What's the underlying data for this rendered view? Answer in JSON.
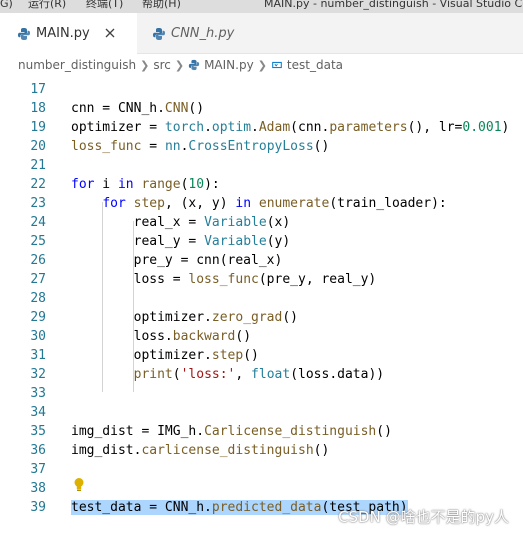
{
  "menu": {
    "edge_label": "G)",
    "run_label": "运行(R)",
    "terminal_label": "终端(T)",
    "help_label": "帮助(H)"
  },
  "window": {
    "title": "MAIN.py - number_distinguish - Visual Studio Co"
  },
  "tabs": [
    {
      "label": "MAIN.py",
      "active": true,
      "icon": "python-icon"
    },
    {
      "label": "CNN_h.py",
      "active": false,
      "icon": "python-icon"
    }
  ],
  "breadcrumb": {
    "folder": "number_distinguish",
    "src": "src",
    "file": "MAIN.py",
    "symbol": "test_data"
  },
  "editor": {
    "lines": [
      {
        "n": "17",
        "code": ""
      },
      {
        "n": "18",
        "code": "cnn = CNN_h.CNN()"
      },
      {
        "n": "19",
        "code": "optimizer = torch.optim.Adam(cnn.parameters(), lr=0.001)"
      },
      {
        "n": "20",
        "code": "loss_func = nn.CrossEntropyLoss()"
      },
      {
        "n": "21",
        "code": ""
      },
      {
        "n": "22",
        "code": "for i in range(10):"
      },
      {
        "n": "23",
        "code": "    for step, (x, y) in enumerate(train_loader):"
      },
      {
        "n": "24",
        "code": "        real_x = Variable(x)"
      },
      {
        "n": "25",
        "code": "        real_y = Variable(y)"
      },
      {
        "n": "26",
        "code": "        pre_y = cnn(real_x)"
      },
      {
        "n": "27",
        "code": "        loss = loss_func(pre_y, real_y)"
      },
      {
        "n": "28",
        "code": ""
      },
      {
        "n": "29",
        "code": "        optimizer.zero_grad()"
      },
      {
        "n": "30",
        "code": "        loss.backward()"
      },
      {
        "n": "31",
        "code": "        optimizer.step()"
      },
      {
        "n": "32",
        "code": "        print('loss:', float(loss.data))"
      },
      {
        "n": "33",
        "code": ""
      },
      {
        "n": "34",
        "code": ""
      },
      {
        "n": "35",
        "code": "img_dist = IMG_h.Carlicense_distinguish()"
      },
      {
        "n": "36",
        "code": "img_dist.carlicense_distinguish()"
      },
      {
        "n": "37",
        "code": ""
      },
      {
        "n": "38",
        "code": ""
      },
      {
        "n": "39",
        "code": "test_data = CNN_h.predicted_data(test_path)"
      }
    ]
  },
  "watermark": "CSDN @啥也不是的py人",
  "colors": {
    "keyword": "#0000ff",
    "function": "#795e26",
    "class": "#267f99",
    "number": "#098658",
    "string": "#a31515",
    "selection": "#add6ff",
    "line_number": "#237893"
  }
}
